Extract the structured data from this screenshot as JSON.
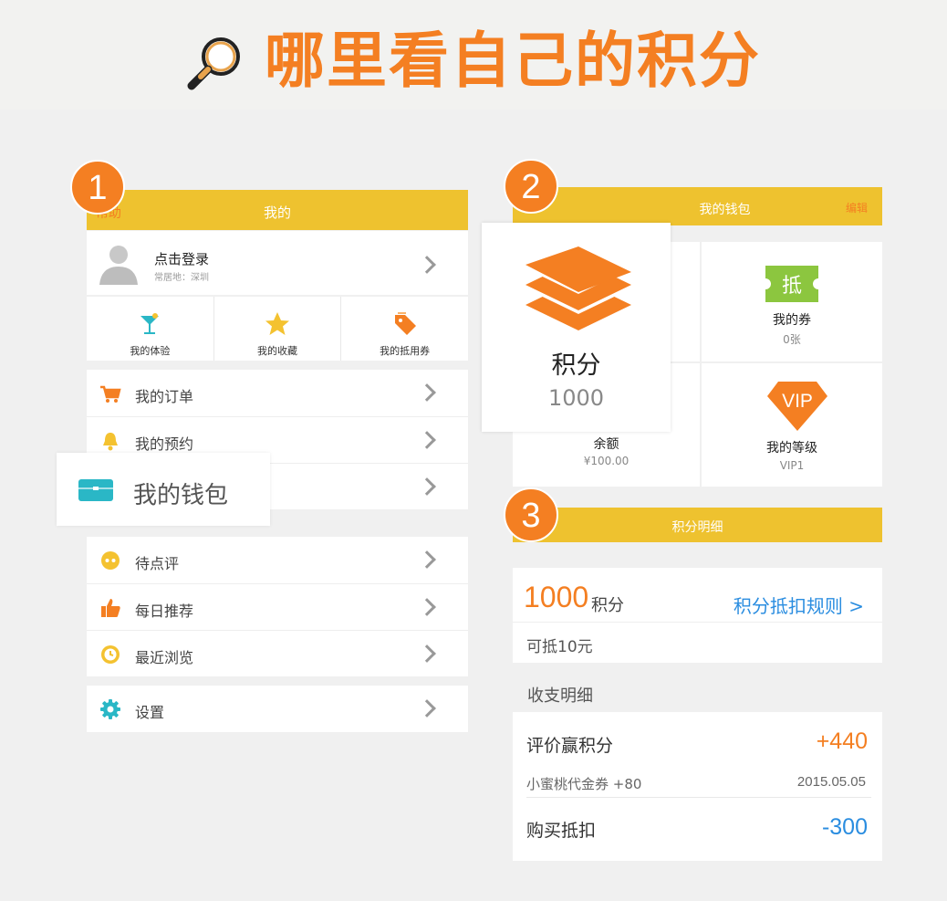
{
  "title": "哪里看自己的积分",
  "steps": [
    "1",
    "2",
    "3"
  ],
  "panel1": {
    "header_left": "帮助",
    "header_title": "我的",
    "login_name": "点击登录",
    "login_sub": "常居地：深圳",
    "quick": [
      {
        "label": "我的体验",
        "icon": "cocktail-icon"
      },
      {
        "label": "我的收藏",
        "icon": "star-icon"
      },
      {
        "label": "我的抵用券",
        "icon": "tag-icon"
      }
    ],
    "menu_group1": [
      {
        "label": "我的订单",
        "icon": "cart-icon"
      },
      {
        "label": "我的预约",
        "icon": "bell-icon"
      },
      {
        "label": "",
        "icon": ""
      }
    ],
    "wallet_popup": "我的钱包",
    "menu_group2": [
      {
        "label": "待点评",
        "icon": "review-icon"
      },
      {
        "label": "每日推荐",
        "icon": "thumb-up-icon"
      },
      {
        "label": "最近浏览",
        "icon": "clock-icon"
      }
    ],
    "menu_group3": [
      {
        "label": "设置",
        "icon": "gear-icon"
      }
    ],
    "colors": {
      "header": "#eec22f",
      "accent": "#f47f22"
    }
  },
  "panel2": {
    "header_title": "我的钱包",
    "edit": "编辑",
    "points_label": "积分",
    "points_value": "1000",
    "coupon_icon_text": "抵",
    "coupon_title": "我的券",
    "coupon_sub": "0张",
    "balance_title": "余额",
    "balance_sub": "¥100.00",
    "vip_icon_text": "VIP",
    "level_title": "我的等级",
    "level_sub": "VIP1"
  },
  "panel3": {
    "header_title": "积分明细",
    "points": "1000",
    "points_unit": "积分",
    "rule_link": "积分抵扣规则 >",
    "cash_note": "可抵10元",
    "section_label": "收支明细",
    "entries": [
      {
        "title": "评价赢积分",
        "amount": "+440",
        "sub": "小蜜桃代金券  +80",
        "date": "2015.05.05",
        "color": "#f47f22"
      },
      {
        "title": "购买抵扣",
        "amount": "-300",
        "color": "#2a8de0"
      }
    ]
  }
}
